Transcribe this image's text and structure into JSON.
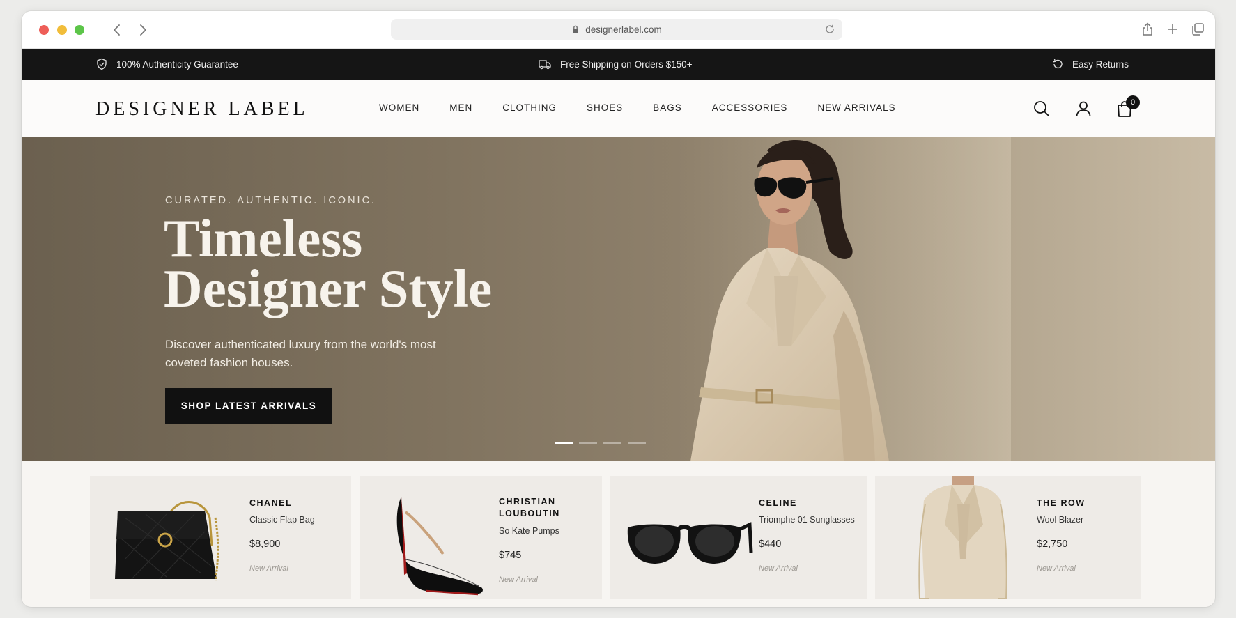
{
  "browser": {
    "url": "designerlabel.com"
  },
  "topbar": {
    "authenticity": "100% Authenticity Guarantee",
    "shipping": "Free Shipping on Orders $150+",
    "returns": "Easy Returns"
  },
  "header": {
    "logo": "DESIGNER LABEL",
    "menu": [
      "WOMEN",
      "MEN",
      "CLOTHING",
      "SHOES",
      "BAGS",
      "ACCESSORIES",
      "NEW ARRIVALS"
    ],
    "cart_count": "0"
  },
  "hero": {
    "eyebrow": "CURATED. AUTHENTIC. ICONIC.",
    "title_line1": "Timeless",
    "title_line2": "Designer Style",
    "subtitle": "Discover authenticated luxury from the world's most coveted fashion houses.",
    "cta": "SHOP LATEST ARRIVALS",
    "slides": 4,
    "active_slide": 1
  },
  "products": [
    {
      "brand": "CHANEL",
      "name": "Classic Flap Bag",
      "price": "$8,900",
      "tag": "New Arrival"
    },
    {
      "brand": "CHRISTIAN LOUBOUTIN",
      "name": "So Kate Pumps",
      "price": "$745",
      "tag": "New Arrival"
    },
    {
      "brand": "CELINE",
      "name": "Triomphe 01 Sunglasses",
      "price": "$440",
      "tag": "New Arrival"
    },
    {
      "brand": "THE ROW",
      "name": "Wool Blazer",
      "price": "$2,750",
      "tag": "New Arrival"
    }
  ],
  "colors": {
    "topbar_bg": "#151515",
    "hero_bg": "#80735f",
    "cta_bg": "#111111",
    "card_bg": "#eeebe7"
  }
}
